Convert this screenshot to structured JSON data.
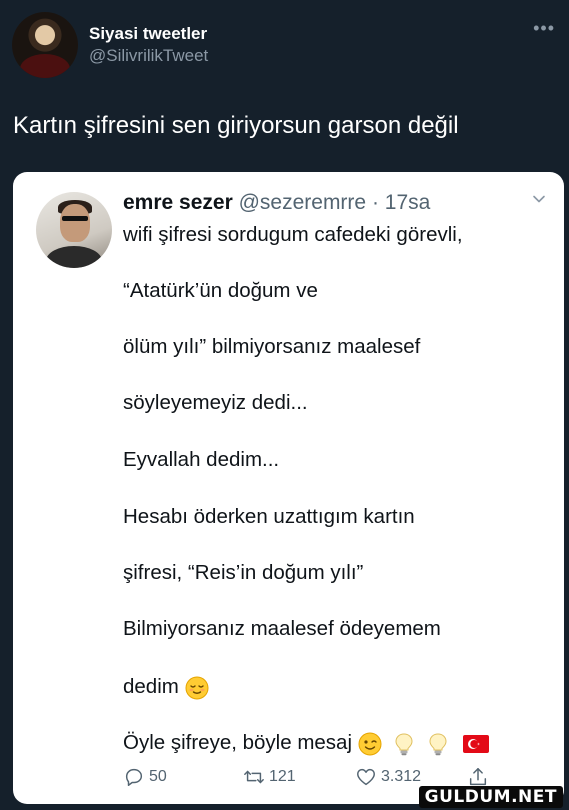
{
  "author": {
    "display_name": "Siyasi tweetler",
    "handle": "@SilivrilikTweet"
  },
  "tweet": {
    "text": "Kartın şifresini sen giriyorsun garson değil"
  },
  "quoted": {
    "display_name": "emre sezer",
    "handle": "@sezeremrre",
    "separator": "·",
    "time": "17sa",
    "lines": [
      "wifi şifresi sordugum cafedeki görevli,",
      "“Atatürk’ün doğum ve",
      "ölüm yılı” bilmiyorsanız maalesef",
      "söyleyemeyiz dedi...",
      "Eyvallah dedim...",
      "Hesabı öderken uzattıgım kartın",
      "şifresi, “Reis’in doğum yılı”",
      "Bilmiyorsanız maalesef ödeyemem",
      "dedim",
      "Öyle şifreye, böyle mesaj"
    ],
    "actions": {
      "replies": "50",
      "retweets": "121",
      "likes": "3.312"
    }
  },
  "icons": {
    "more": "more-dots-icon",
    "chevron": "chevron-down-icon",
    "reply": "reply-icon",
    "retweet": "retweet-icon",
    "like": "heart-icon",
    "share": "share-icon",
    "relieved_face": "relieved-face-emoji",
    "winking_face": "winking-face-emoji",
    "bulb": "light-bulb-emoji",
    "flag": "turkey-flag-emoji"
  },
  "watermark": "GULDUM.NET",
  "colors": {
    "background": "#15202b",
    "card": "#ffffff",
    "muted": "#8b98a5",
    "text_dark": "#0f1419",
    "muted_dark": "#536471"
  }
}
